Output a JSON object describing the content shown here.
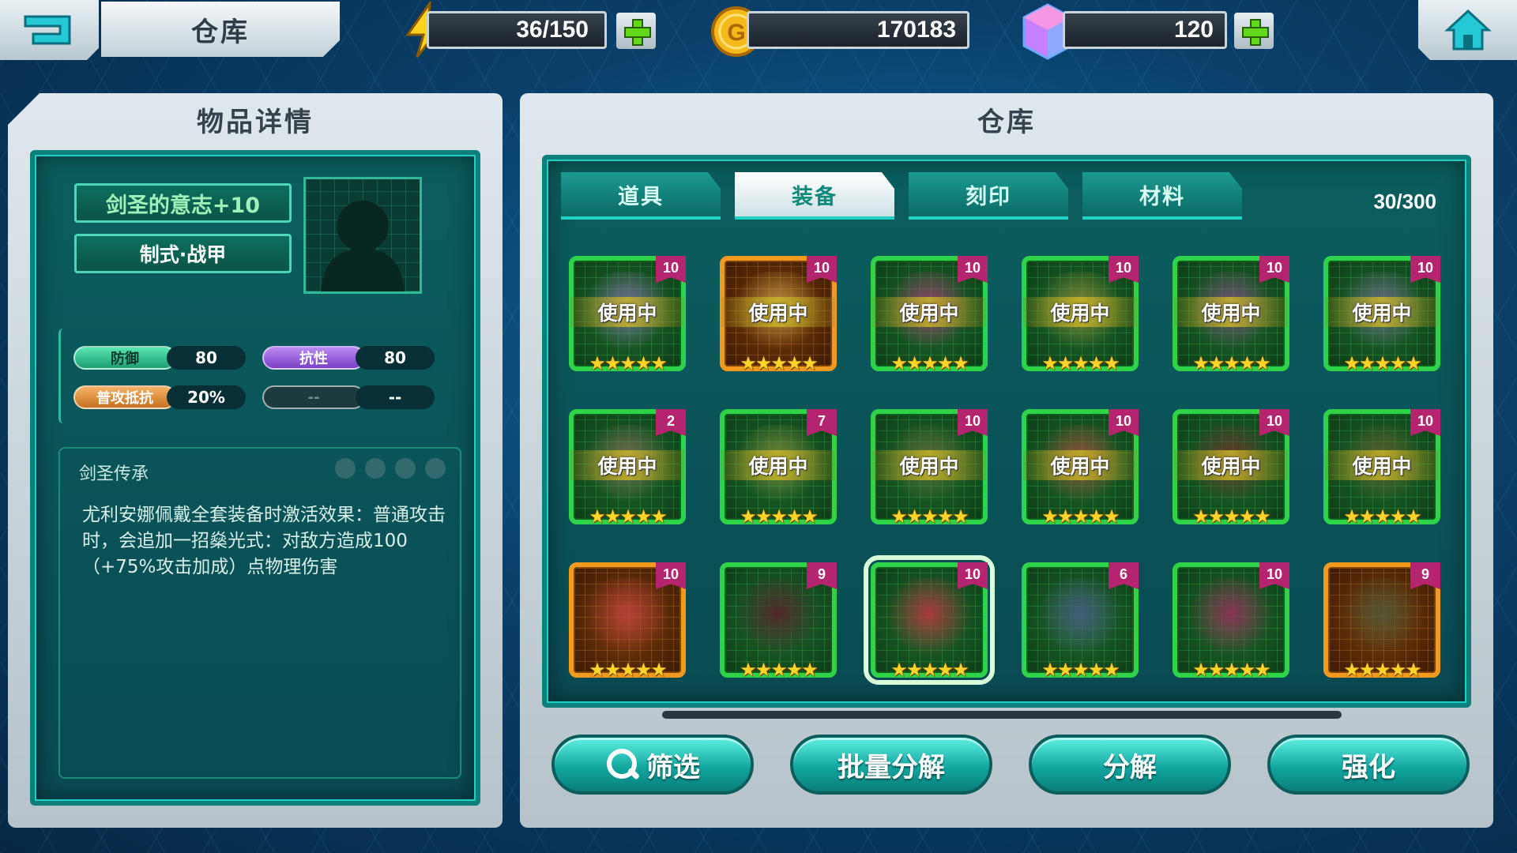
{
  "topbar": {
    "title": "仓库",
    "energy": "36/150",
    "gold": "170183",
    "gems": "120"
  },
  "detail": {
    "panel_title": "物品详情",
    "item_name": "剑圣的意志+10",
    "item_type": "制式·战甲",
    "stats": [
      {
        "label": "防御",
        "value": "80"
      },
      {
        "label": "抗性",
        "value": "80"
      },
      {
        "label": "普攻抵抗",
        "value": "20%"
      },
      {
        "label": "--",
        "value": "--"
      }
    ],
    "set_name": "剑圣传承",
    "set_description": "尤利安娜佩戴全套装备时激活效果：普通攻击时，会追加一招燊光式：对敌方造成100（+75%攻击加成）点物理伤害"
  },
  "warehouse": {
    "panel_title": "仓库",
    "tabs": [
      {
        "label": "道具",
        "active": false
      },
      {
        "label": "装备",
        "active": true
      },
      {
        "label": "刻印",
        "active": false
      },
      {
        "label": "材料",
        "active": false
      }
    ],
    "capacity": "30/300",
    "in_use_label": "使用中",
    "stars": "★★★★★",
    "items": [
      {
        "level": "10",
        "in_use": true,
        "rarity": "green",
        "art": "#8a6fb0"
      },
      {
        "level": "10",
        "in_use": true,
        "rarity": "orange",
        "art": "#c9a14a"
      },
      {
        "level": "10",
        "in_use": true,
        "rarity": "green",
        "art": "#b03a7a"
      },
      {
        "level": "10",
        "in_use": true,
        "rarity": "green",
        "art": "#9a8a3a"
      },
      {
        "level": "10",
        "in_use": true,
        "rarity": "green",
        "art": "#8a4a8a"
      },
      {
        "level": "10",
        "in_use": true,
        "rarity": "green",
        "art": "#7a6a9a"
      },
      {
        "level": "2",
        "in_use": true,
        "rarity": "green",
        "art": "#8a6a5a"
      },
      {
        "level": "7",
        "in_use": true,
        "rarity": "green",
        "art": "#8a8a3a"
      },
      {
        "level": "10",
        "in_use": true,
        "rarity": "green",
        "art": "#6a6a3a"
      },
      {
        "level": "10",
        "in_use": true,
        "rarity": "green",
        "art": "#b04a3a"
      },
      {
        "level": "10",
        "in_use": true,
        "rarity": "green",
        "art": "#7a2a2a"
      },
      {
        "level": "10",
        "in_use": true,
        "rarity": "green",
        "art": "#6a5a2a"
      },
      {
        "level": "10",
        "in_use": false,
        "rarity": "orange",
        "art": "#c04040"
      },
      {
        "level": "9",
        "in_use": false,
        "rarity": "green",
        "art": "#5a1a2a"
      },
      {
        "level": "10",
        "in_use": false,
        "rarity": "green",
        "art": "#c03040",
        "selected": true
      },
      {
        "level": "6",
        "in_use": false,
        "rarity": "green",
        "art": "#4a5a8a"
      },
      {
        "level": "10",
        "in_use": false,
        "rarity": "green",
        "art": "#9a2a5a"
      },
      {
        "level": "9",
        "in_use": false,
        "rarity": "orange",
        "art": "#4a5a3a"
      }
    ]
  },
  "actions": {
    "filter": "筛选",
    "batch_decompose": "批量分解",
    "decompose": "分解",
    "enhance": "强化"
  },
  "colors": {
    "accent_teal": "#12a7a0",
    "rarity_green": "#2ed34a",
    "rarity_orange": "#f19a1e",
    "level_badge": "#b5246e"
  }
}
